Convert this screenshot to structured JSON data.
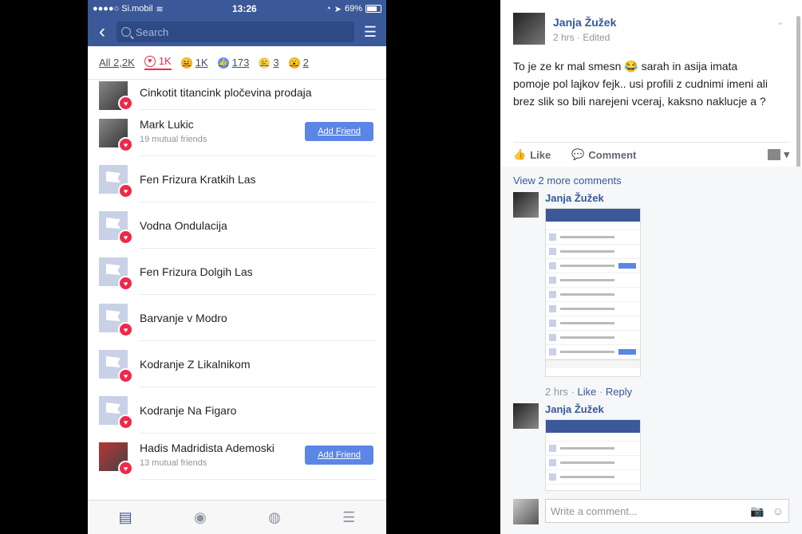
{
  "phone": {
    "status": {
      "carrier": "●●●●○ Si.mobil",
      "time": "13:26",
      "battery": "69%",
      "wifi_icon": "wifi-icon",
      "battery_level": 0.69
    },
    "nav": {
      "search_placeholder": "Search"
    },
    "tabs": [
      {
        "label": "All 2,2K"
      },
      {
        "label": "1K",
        "icon": "love"
      },
      {
        "label": "1K",
        "icon": "haha"
      },
      {
        "label": "173",
        "icon": "like"
      },
      {
        "label": "3",
        "icon": "sad"
      },
      {
        "label": "2",
        "icon": "wow"
      }
    ],
    "rows": [
      {
        "name": "Cinkotit titancink pločevina prodaja",
        "sub": "",
        "button": ""
      },
      {
        "name": "Mark Lukic",
        "sub": "19 mutual friends",
        "button": "Add Friend"
      },
      {
        "name": "Fen Frizura Kratkih Las",
        "sub": "",
        "button": ""
      },
      {
        "name": "Vodna Ondulacija",
        "sub": "",
        "button": ""
      },
      {
        "name": "Fen Frizura Dolgih Las",
        "sub": "",
        "button": ""
      },
      {
        "name": "Barvanje v Modro",
        "sub": "",
        "button": ""
      },
      {
        "name": "Kodranje Z Likalnikom",
        "sub": "",
        "button": ""
      },
      {
        "name": "Kodranje Na Figaro",
        "sub": "",
        "button": ""
      },
      {
        "name": "Hadis Madridista Ademoski",
        "sub": "13 mutual friends",
        "button": "Add Friend"
      }
    ]
  },
  "post": {
    "author": "Janja Žužek",
    "meta": "2 hrs · Edited",
    "text": "To je ze kr mal smesn 😂 sarah in asija imata pomoje pol lajkov fejk.. usi profili z cudnimi imeni ali brez slik so bili narejeni vceraj, kaksno naklucje a ?",
    "like_label": "Like",
    "comment_label": "Comment",
    "more_comments": "View 2 more comments",
    "comments": [
      {
        "author": "Janja Žužek",
        "time": "2 hrs",
        "like": "Like",
        "reply": "Reply"
      },
      {
        "author": "Janja Žužek"
      }
    ],
    "write_placeholder": "Write a comment..."
  },
  "colors": {
    "brand": "#3b5998",
    "love": "#f02849",
    "button": "#5b86e5"
  }
}
